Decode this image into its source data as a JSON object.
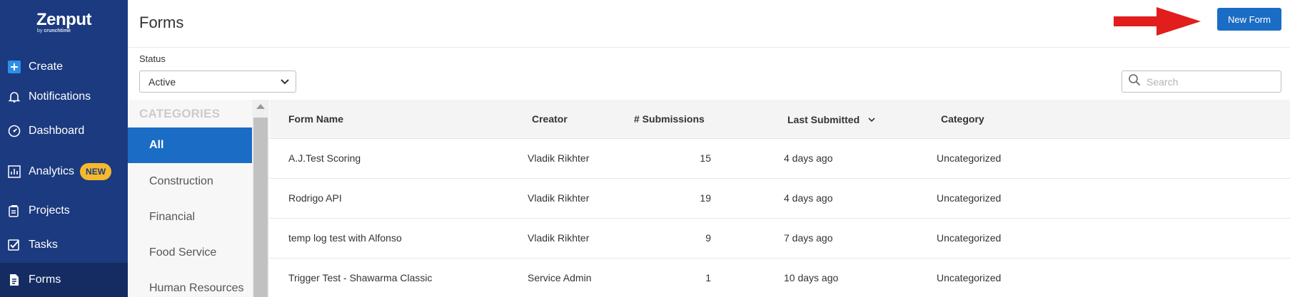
{
  "brand": {
    "logo_text": "Zenput",
    "logo_sub_prefix": "by ",
    "logo_sub_brand": "crunchtime"
  },
  "sidebar": {
    "items": [
      {
        "label": "Create",
        "icon": "plus-square-icon"
      },
      {
        "label": "Notifications",
        "icon": "bell-icon"
      },
      {
        "label": "Dashboard",
        "icon": "gauge-icon"
      },
      {
        "label": "Analytics",
        "icon": "chart-icon",
        "badge": "NEW"
      },
      {
        "label": "Projects",
        "icon": "clipboard-icon"
      },
      {
        "label": "Tasks",
        "icon": "checkbox-icon"
      },
      {
        "label": "Forms",
        "icon": "document-icon",
        "active": true
      }
    ]
  },
  "header": {
    "title": "Forms",
    "new_form_label": "New Form"
  },
  "filters": {
    "status_label": "Status",
    "status_value": "Active",
    "search_placeholder": "Search"
  },
  "categories": {
    "title": "CATEGORIES",
    "items": [
      "All",
      "Construction",
      "Financial",
      "Food Service",
      "Human Resources"
    ],
    "active": "All"
  },
  "table": {
    "columns": [
      "Form Name",
      "Creator",
      "# Submissions",
      "Last Submitted",
      "Category"
    ],
    "sorted_by": "Last Submitted",
    "rows": [
      {
        "name": "A.J.Test Scoring",
        "creator": "Vladik Rikhter",
        "submissions": "15",
        "last": "4 days ago",
        "category": "Uncategorized"
      },
      {
        "name": "Rodrigo API",
        "creator": "Vladik Rikhter",
        "submissions": "19",
        "last": "4 days ago",
        "category": "Uncategorized"
      },
      {
        "name": "temp log test with Alfonso",
        "creator": "Vladik Rikhter",
        "submissions": "9",
        "last": "7 days ago",
        "category": "Uncategorized"
      },
      {
        "name": "Trigger Test - Shawarma Classic",
        "creator": "Service Admin",
        "submissions": "1",
        "last": "10 days ago",
        "category": "Uncategorized"
      }
    ]
  },
  "colors": {
    "sidebar_bg": "#1b3a7f",
    "accent_blue": "#1b6cc5",
    "badge_yellow": "#f5b82e",
    "arrow_red": "#e11d1d"
  }
}
